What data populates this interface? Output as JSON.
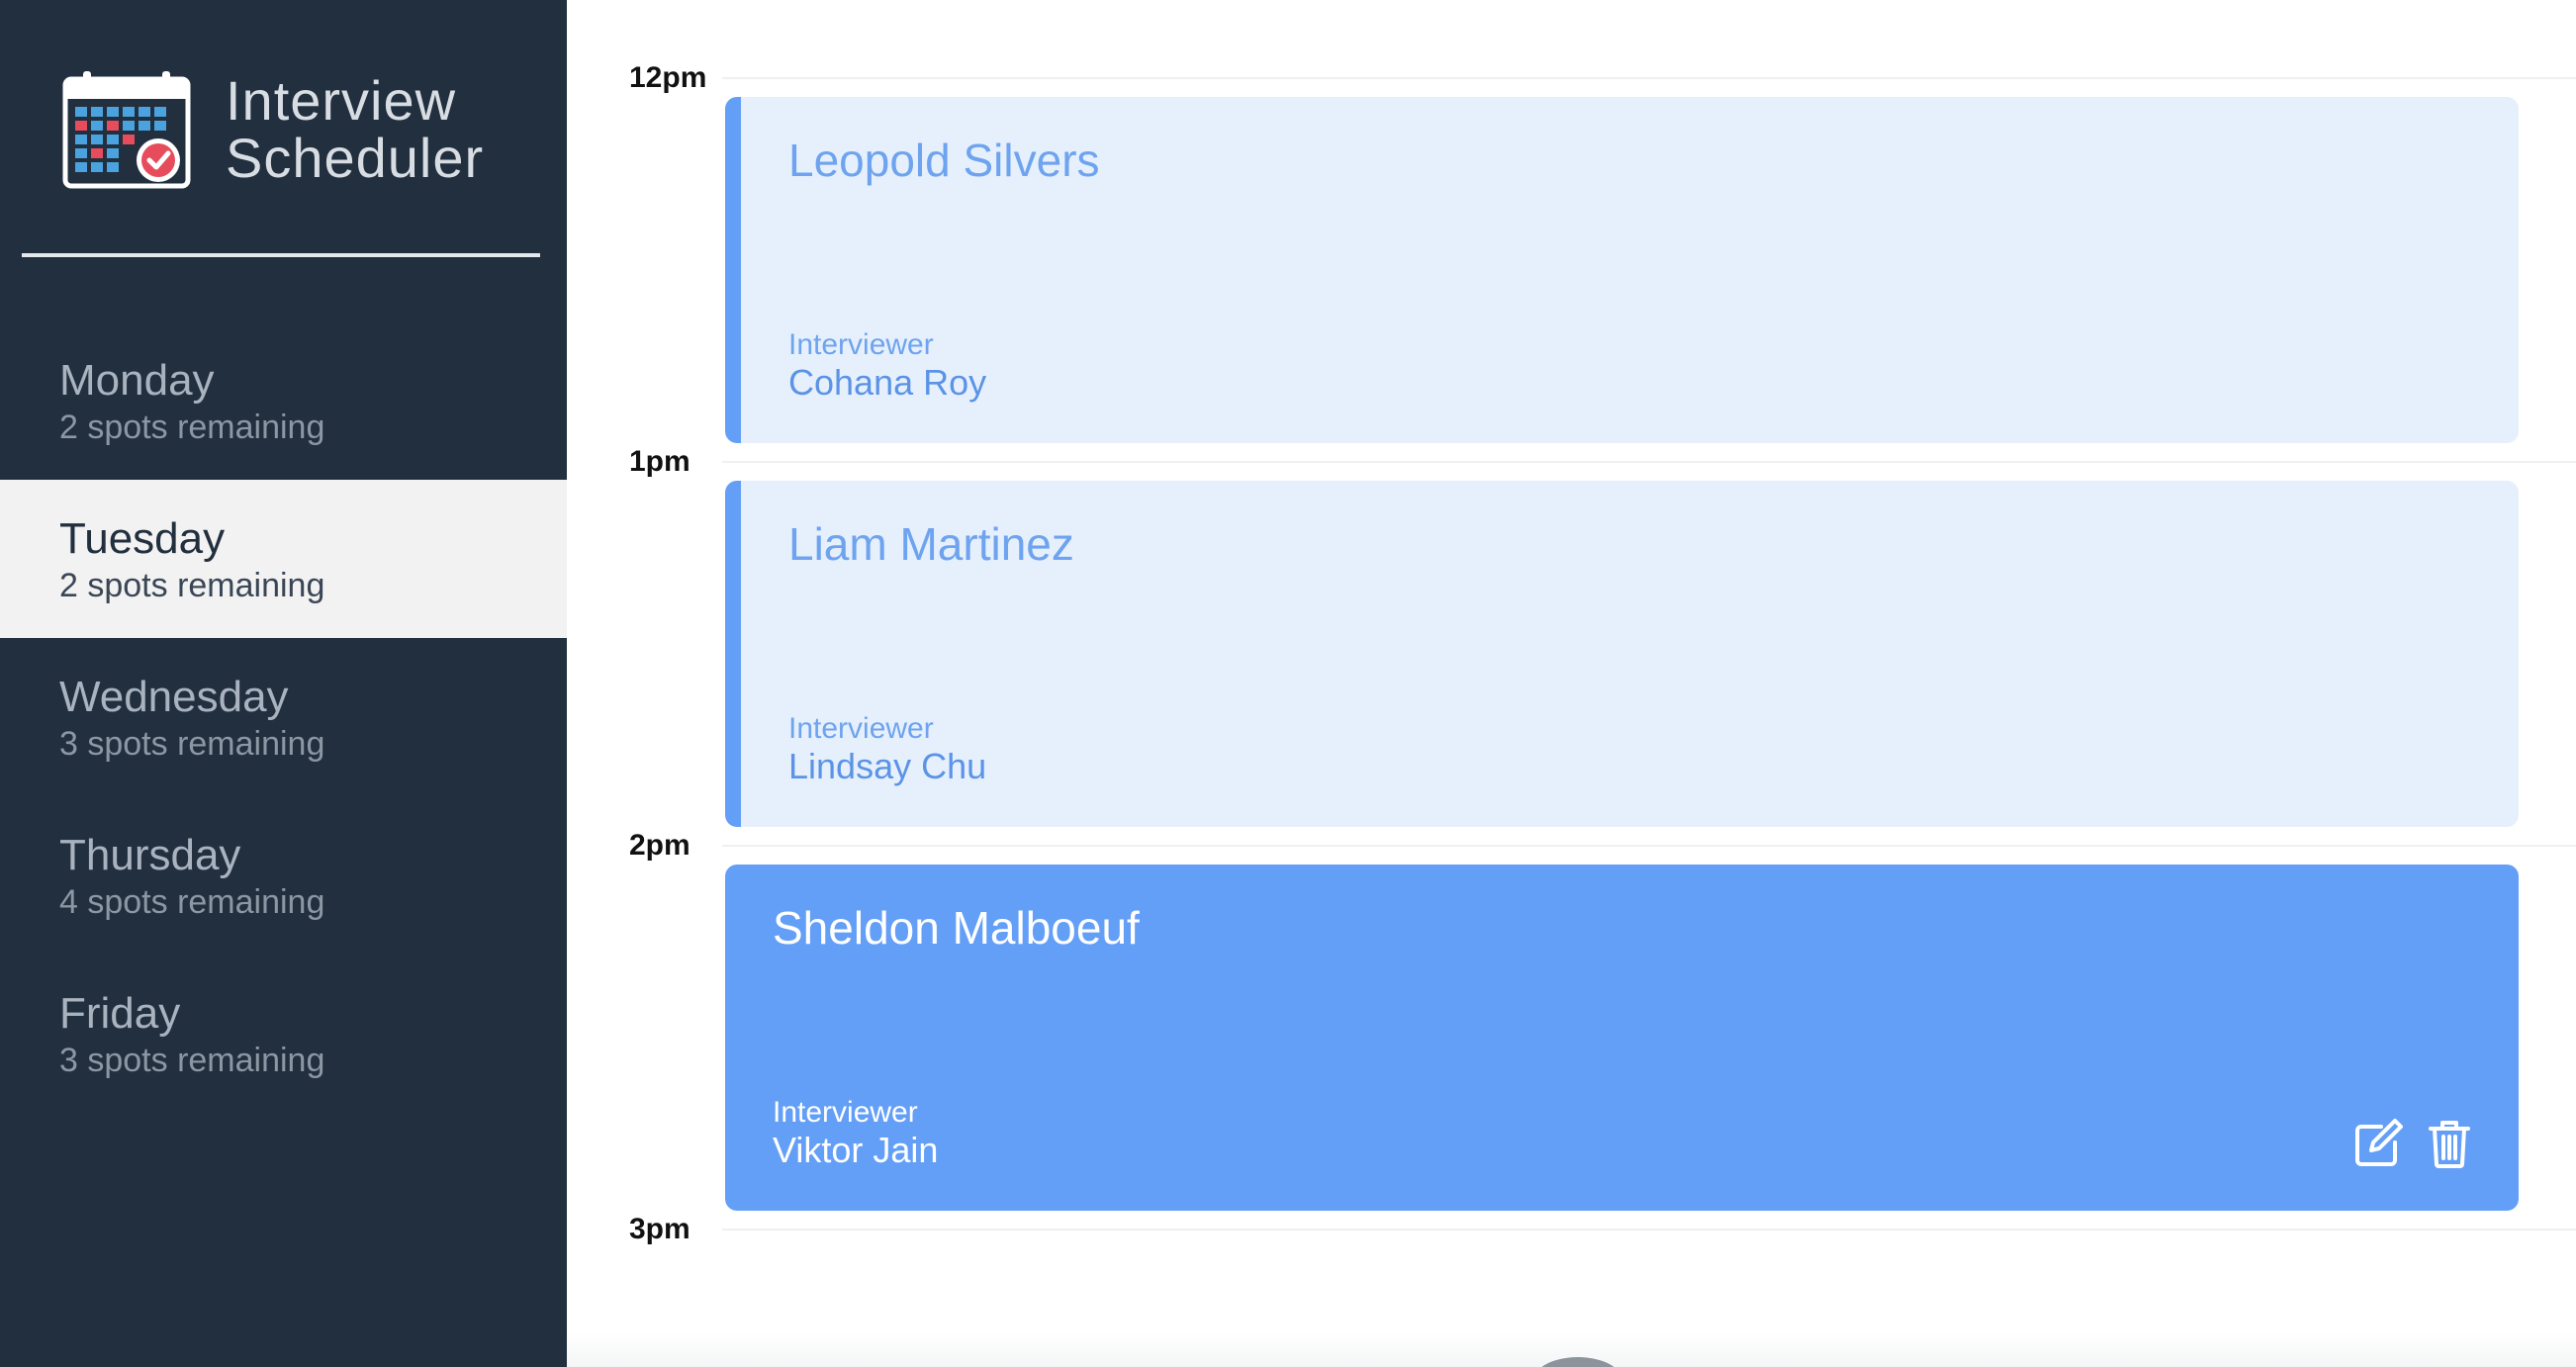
{
  "app": {
    "title_line1": "Interview",
    "title_line2": "Scheduler",
    "logo_icon": "calendar-check-icon"
  },
  "sidebar": {
    "days": [
      {
        "name": "Monday",
        "spots": "2 spots remaining",
        "selected": false
      },
      {
        "name": "Tuesday",
        "spots": "2 spots remaining",
        "selected": true
      },
      {
        "name": "Wednesday",
        "spots": "3 spots remaining",
        "selected": false
      },
      {
        "name": "Thursday",
        "spots": "4 spots remaining",
        "selected": false
      },
      {
        "name": "Friday",
        "spots": "3 spots remaining",
        "selected": false
      }
    ]
  },
  "schedule": {
    "times": [
      "12pm",
      "1pm",
      "2pm",
      "3pm"
    ],
    "appointments": [
      {
        "student": "Leopold Silvers",
        "interviewer_label": "Interviewer",
        "interviewer": "Cohana Roy",
        "state": "normal"
      },
      {
        "student": "Liam Martinez",
        "interviewer_label": "Interviewer",
        "interviewer": "Lindsay Chu",
        "state": "normal"
      },
      {
        "student": "Sheldon Malboeuf",
        "interviewer_label": "Interviewer",
        "interviewer": "Viktor Jain",
        "state": "hover",
        "actions": [
          "edit-icon",
          "trash-icon"
        ]
      }
    ]
  },
  "colors": {
    "sidebar_bg": "#222f3e",
    "appointment_light": "#e6f0fd",
    "appointment_accent": "#649ff7",
    "selected_day_bg": "#f2f2f2"
  }
}
